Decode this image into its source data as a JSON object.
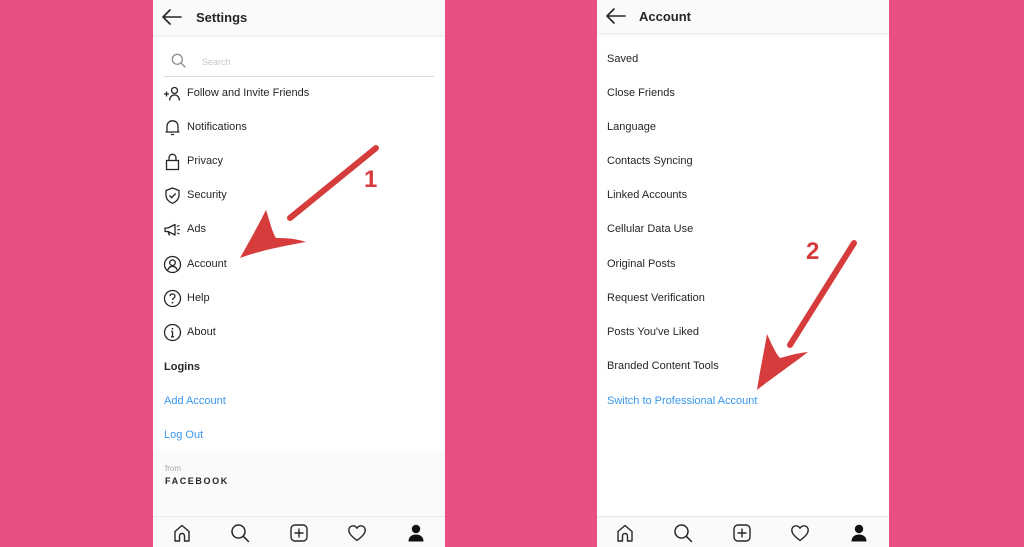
{
  "colors": {
    "background": "#e84f80",
    "link_blue": "#3897f0",
    "annotation_red": "#d63c3c",
    "text": "#262626"
  },
  "left_screen": {
    "header": {
      "back_icon": "arrow-left-icon",
      "title": "Settings"
    },
    "search": {
      "icon": "search-icon",
      "placeholder": "Search",
      "value": ""
    },
    "menu_items": [
      {
        "label": "Follow and Invite Friends",
        "icon": "add-person-icon"
      },
      {
        "label": "Notifications",
        "icon": "bell-icon"
      },
      {
        "label": "Privacy",
        "icon": "lock-icon"
      },
      {
        "label": "Security",
        "icon": "shield-check-icon"
      },
      {
        "label": "Ads",
        "icon": "megaphone-icon"
      },
      {
        "label": "Account",
        "icon": "user-circle-icon"
      },
      {
        "label": "Help",
        "icon": "question-circle-icon"
      },
      {
        "label": "About",
        "icon": "info-circle-icon"
      }
    ],
    "logins": {
      "header": "Logins",
      "add_account": "Add Account",
      "log_out": "Log Out"
    },
    "footer": {
      "from": "from",
      "brand": "FACEBOOK"
    }
  },
  "right_screen": {
    "header": {
      "back_icon": "arrow-left-icon",
      "title": "Account"
    },
    "menu_items": [
      {
        "label": "Saved"
      },
      {
        "label": "Close Friends"
      },
      {
        "label": "Language"
      },
      {
        "label": "Contacts Syncing"
      },
      {
        "label": "Linked Accounts"
      },
      {
        "label": "Cellular Data Use"
      },
      {
        "label": "Original Posts"
      },
      {
        "label": "Request Verification"
      },
      {
        "label": "Posts You've Liked"
      },
      {
        "label": "Branded Content Tools"
      }
    ],
    "switch_link": "Switch to Professional Account"
  },
  "tab_bar": {
    "tabs": [
      {
        "name": "home",
        "icon": "home-icon"
      },
      {
        "name": "search",
        "icon": "search-icon"
      },
      {
        "name": "new-post",
        "icon": "plus-square-icon"
      },
      {
        "name": "activity",
        "icon": "heart-icon"
      },
      {
        "name": "profile",
        "icon": "profile-icon",
        "active": true
      }
    ]
  },
  "annotations": {
    "step_1": "1",
    "step_2": "2"
  }
}
